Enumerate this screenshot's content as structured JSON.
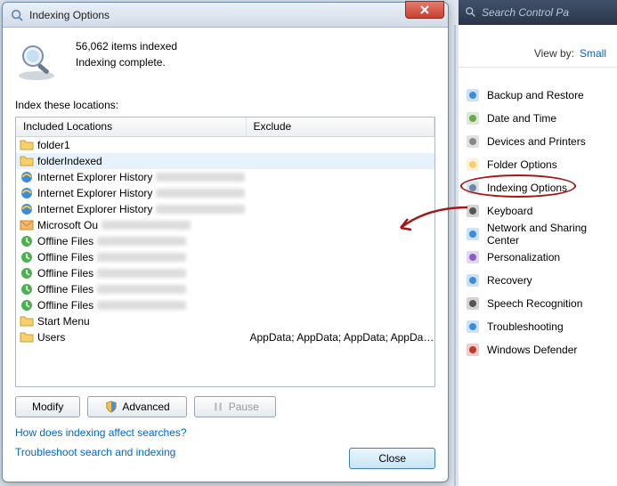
{
  "dialog": {
    "title": "Indexing Options",
    "items_indexed": "56,062 items indexed",
    "status": "Indexing complete.",
    "instructions": "Index these locations:",
    "columns": {
      "included": "Included Locations",
      "exclude": "Exclude"
    },
    "rows": [
      {
        "icon": "folder",
        "label": "folder1",
        "exclude": "",
        "selected": false,
        "blurred": false
      },
      {
        "icon": "folder",
        "label": "folderIndexed",
        "exclude": "",
        "selected": true,
        "blurred": false
      },
      {
        "icon": "ie",
        "label": "Internet Explorer History",
        "exclude": "",
        "selected": false,
        "blurred": true
      },
      {
        "icon": "ie",
        "label": "Internet Explorer History",
        "exclude": "",
        "selected": false,
        "blurred": true
      },
      {
        "icon": "ie",
        "label": "Internet Explorer History",
        "exclude": "",
        "selected": false,
        "blurred": true
      },
      {
        "icon": "outlook",
        "label": "Microsoft Ou",
        "exclude": "",
        "selected": false,
        "blurred": true
      },
      {
        "icon": "offline",
        "label": "Offline Files",
        "exclude": "",
        "selected": false,
        "blurred": true
      },
      {
        "icon": "offline",
        "label": "Offline Files",
        "exclude": "",
        "selected": false,
        "blurred": true
      },
      {
        "icon": "offline",
        "label": "Offline Files",
        "exclude": "",
        "selected": false,
        "blurred": true
      },
      {
        "icon": "offline",
        "label": "Offline Files",
        "exclude": "",
        "selected": false,
        "blurred": true
      },
      {
        "icon": "offline",
        "label": "Offline Files",
        "exclude": "",
        "selected": false,
        "blurred": true
      },
      {
        "icon": "folder",
        "label": "Start Menu",
        "exclude": "",
        "selected": false,
        "blurred": false
      },
      {
        "icon": "folder",
        "label": "Users",
        "exclude": "AppData; AppData; AppData; AppData; A...",
        "selected": false,
        "blurred": false
      }
    ],
    "buttons": {
      "modify": "Modify",
      "advanced": "Advanced",
      "pause": "Pause",
      "close": "Close"
    },
    "links": {
      "help": "How does indexing affect searches?",
      "troubleshoot": "Troubleshoot search and indexing"
    }
  },
  "right": {
    "search_placeholder": "Search Control Pa",
    "viewby_label": "View by:",
    "viewby_value": "Small",
    "items": [
      {
        "icon": "backup",
        "label": "Backup and Restore"
      },
      {
        "icon": "datetime",
        "label": "Date and Time"
      },
      {
        "icon": "devices",
        "label": "Devices and Printers"
      },
      {
        "icon": "folderopt",
        "label": "Folder Options"
      },
      {
        "icon": "indexing",
        "label": "Indexing Options",
        "circled": true
      },
      {
        "icon": "keyboard",
        "label": "Keyboard"
      },
      {
        "icon": "network",
        "label": "Network and Sharing Center"
      },
      {
        "icon": "personalization",
        "label": "Personalization"
      },
      {
        "icon": "recovery",
        "label": "Recovery"
      },
      {
        "icon": "speech",
        "label": "Speech Recognition"
      },
      {
        "icon": "troubleshooting",
        "label": "Troubleshooting"
      },
      {
        "icon": "defender",
        "label": "Windows Defender"
      }
    ]
  }
}
